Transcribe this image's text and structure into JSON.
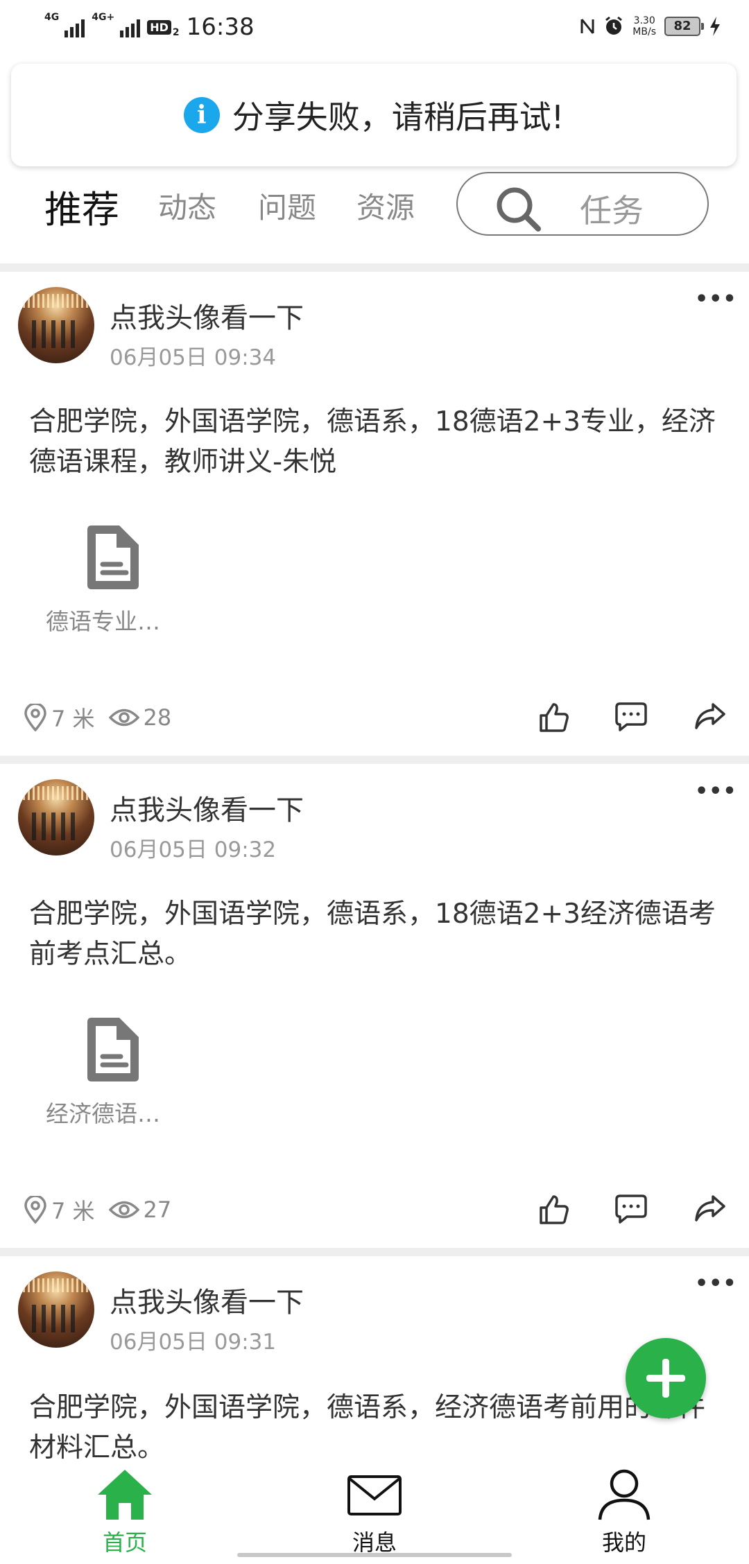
{
  "status_bar": {
    "network1": "4G",
    "network2": "4G+",
    "hd": "HD",
    "hd_sub": "2",
    "time": "16:38",
    "speed_value": "3.30",
    "speed_unit": "MB/s",
    "battery": "82"
  },
  "toast": {
    "text": "分享失败，请稍后再试!"
  },
  "tabs": {
    "items": [
      {
        "label": "推荐",
        "active": true
      },
      {
        "label": "动态",
        "active": false
      },
      {
        "label": "问题",
        "active": false
      },
      {
        "label": "资源",
        "active": false
      }
    ],
    "search_label": "任务"
  },
  "posts": [
    {
      "user": "点我头像看一下",
      "date": "06月05日 09:34",
      "content": "合肥学院，外国语学院，德语系，18德语2+3专业，经济德语课程，教师讲义-朱悦",
      "file": "德语专业…",
      "distance": "7 米",
      "views": "28"
    },
    {
      "user": "点我头像看一下",
      "date": "06月05日 09:32",
      "content": "合肥学院，外国语学院，德语系，18德语2+3经济德语考前考点汇总。",
      "file": "经济德语…",
      "distance": "7 米",
      "views": "27"
    },
    {
      "user": "点我头像看一下",
      "date": "06月05日 09:31",
      "content": "合肥学院，外国语学院，德语系，经济德语考前用的课件材料汇总。"
    }
  ],
  "bottom_nav": {
    "items": [
      {
        "label": "首页",
        "active": true
      },
      {
        "label": "消息",
        "active": false
      },
      {
        "label": "我的",
        "active": false
      }
    ]
  },
  "colors": {
    "accent_green": "#2bb14a",
    "info_blue": "#1aa7ec"
  }
}
